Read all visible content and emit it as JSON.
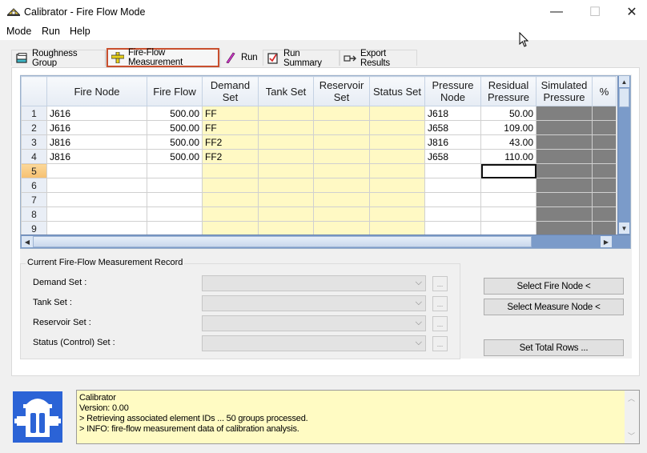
{
  "window": {
    "title": "Calibrator - Fire Flow Mode",
    "icon": "calibrator-app-icon",
    "controls": {
      "minimize": "—",
      "maximize": "☐",
      "close": "✕"
    }
  },
  "menu": [
    "Mode",
    "Run",
    "Help"
  ],
  "tabs": [
    {
      "label": "Roughness Group",
      "icon": "roughness-group-icon",
      "active": false
    },
    {
      "label": "Fire-Flow Measurement",
      "icon": "fire-flow-measurement-icon",
      "active": true
    },
    {
      "label": "Run",
      "icon": "run-icon",
      "active": false
    },
    {
      "label": "Run Summary",
      "icon": "run-summary-icon",
      "active": false
    },
    {
      "label": "Export Results",
      "icon": "export-results-icon",
      "active": false
    }
  ],
  "grid": {
    "columns": [
      "Fire Node",
      "Fire Flow",
      "Demand Set",
      "Tank Set",
      "Reservoir Set",
      "Status Set",
      "Pressure Node",
      "Residual Pressure",
      "Simulated Pressure",
      "%"
    ],
    "column_headers": [
      [
        "Fire Node"
      ],
      [
        "Fire Flow"
      ],
      [
        "Demand",
        "Set"
      ],
      [
        "Tank Set"
      ],
      [
        "Reservoir",
        "Set"
      ],
      [
        "Status Set"
      ],
      [
        "Pressure",
        "Node"
      ],
      [
        "Residual",
        "Pressure"
      ],
      [
        "Simulated",
        "Pressure"
      ],
      [
        "%"
      ]
    ],
    "selected_column": "Residual Pressure",
    "selected_row": 5,
    "rows": [
      {
        "n": "1",
        "fire_node": "J616",
        "fire_flow": "500.00",
        "demand_set": "FF",
        "tank_set": "",
        "reservoir_set": "",
        "status_set": "",
        "pressure_node": "J618",
        "residual_pressure": "50.00"
      },
      {
        "n": "2",
        "fire_node": "J616",
        "fire_flow": "500.00",
        "demand_set": "FF",
        "tank_set": "",
        "reservoir_set": "",
        "status_set": "",
        "pressure_node": "J658",
        "residual_pressure": "109.00"
      },
      {
        "n": "3",
        "fire_node": "J816",
        "fire_flow": "500.00",
        "demand_set": "FF2",
        "tank_set": "",
        "reservoir_set": "",
        "status_set": "",
        "pressure_node": "J816",
        "residual_pressure": "43.00"
      },
      {
        "n": "4",
        "fire_node": "J816",
        "fire_flow": "500.00",
        "demand_set": "FF2",
        "tank_set": "",
        "reservoir_set": "",
        "status_set": "",
        "pressure_node": "J658",
        "residual_pressure": "110.00"
      },
      {
        "n": "5",
        "fire_node": "",
        "fire_flow": "",
        "demand_set": "",
        "tank_set": "",
        "reservoir_set": "",
        "status_set": "",
        "pressure_node": "",
        "residual_pressure": ""
      },
      {
        "n": "6",
        "fire_node": "",
        "fire_flow": "",
        "demand_set": "",
        "tank_set": "",
        "reservoir_set": "",
        "status_set": "",
        "pressure_node": "",
        "residual_pressure": ""
      },
      {
        "n": "7",
        "fire_node": "",
        "fire_flow": "",
        "demand_set": "",
        "tank_set": "",
        "reservoir_set": "",
        "status_set": "",
        "pressure_node": "",
        "residual_pressure": ""
      },
      {
        "n": "8",
        "fire_node": "",
        "fire_flow": "",
        "demand_set": "",
        "tank_set": "",
        "reservoir_set": "",
        "status_set": "",
        "pressure_node": "",
        "residual_pressure": ""
      },
      {
        "n": "9",
        "fire_node": "",
        "fire_flow": "",
        "demand_set": "",
        "tank_set": "",
        "reservoir_set": "",
        "status_set": "",
        "pressure_node": "",
        "residual_pressure": ""
      }
    ],
    "colors": {
      "editable_set": "#fff9c4",
      "readonly": "#808080",
      "selected_header": "#f6c070",
      "scrollbar": "#7b9bc9"
    }
  },
  "record": {
    "title": "Current Fire-Flow Measurement Record",
    "fields": [
      {
        "label": "Demand Set :",
        "value": ""
      },
      {
        "label": "Tank Set :",
        "value": ""
      },
      {
        "label": "Reservoir Set :",
        "value": ""
      },
      {
        "label": "Status (Control) Set :",
        "value": ""
      }
    ],
    "ellipsis_label": "..."
  },
  "buttons": {
    "select_fire_node": "Select Fire Node <",
    "select_measure_node": "Select Measure Node <",
    "set_total_rows": "Set Total Rows ..."
  },
  "log": {
    "lines": [
      "Calibrator",
      "Version: 0.00",
      "> Retrieving associated element IDs ... 50 groups processed.",
      "> INFO: fire-flow measurement data of calibration analysis."
    ],
    "background": "#fffbc3"
  },
  "accent": {
    "active_tab_border": "#c94f2e",
    "logo_blue": "#2b63d6"
  }
}
